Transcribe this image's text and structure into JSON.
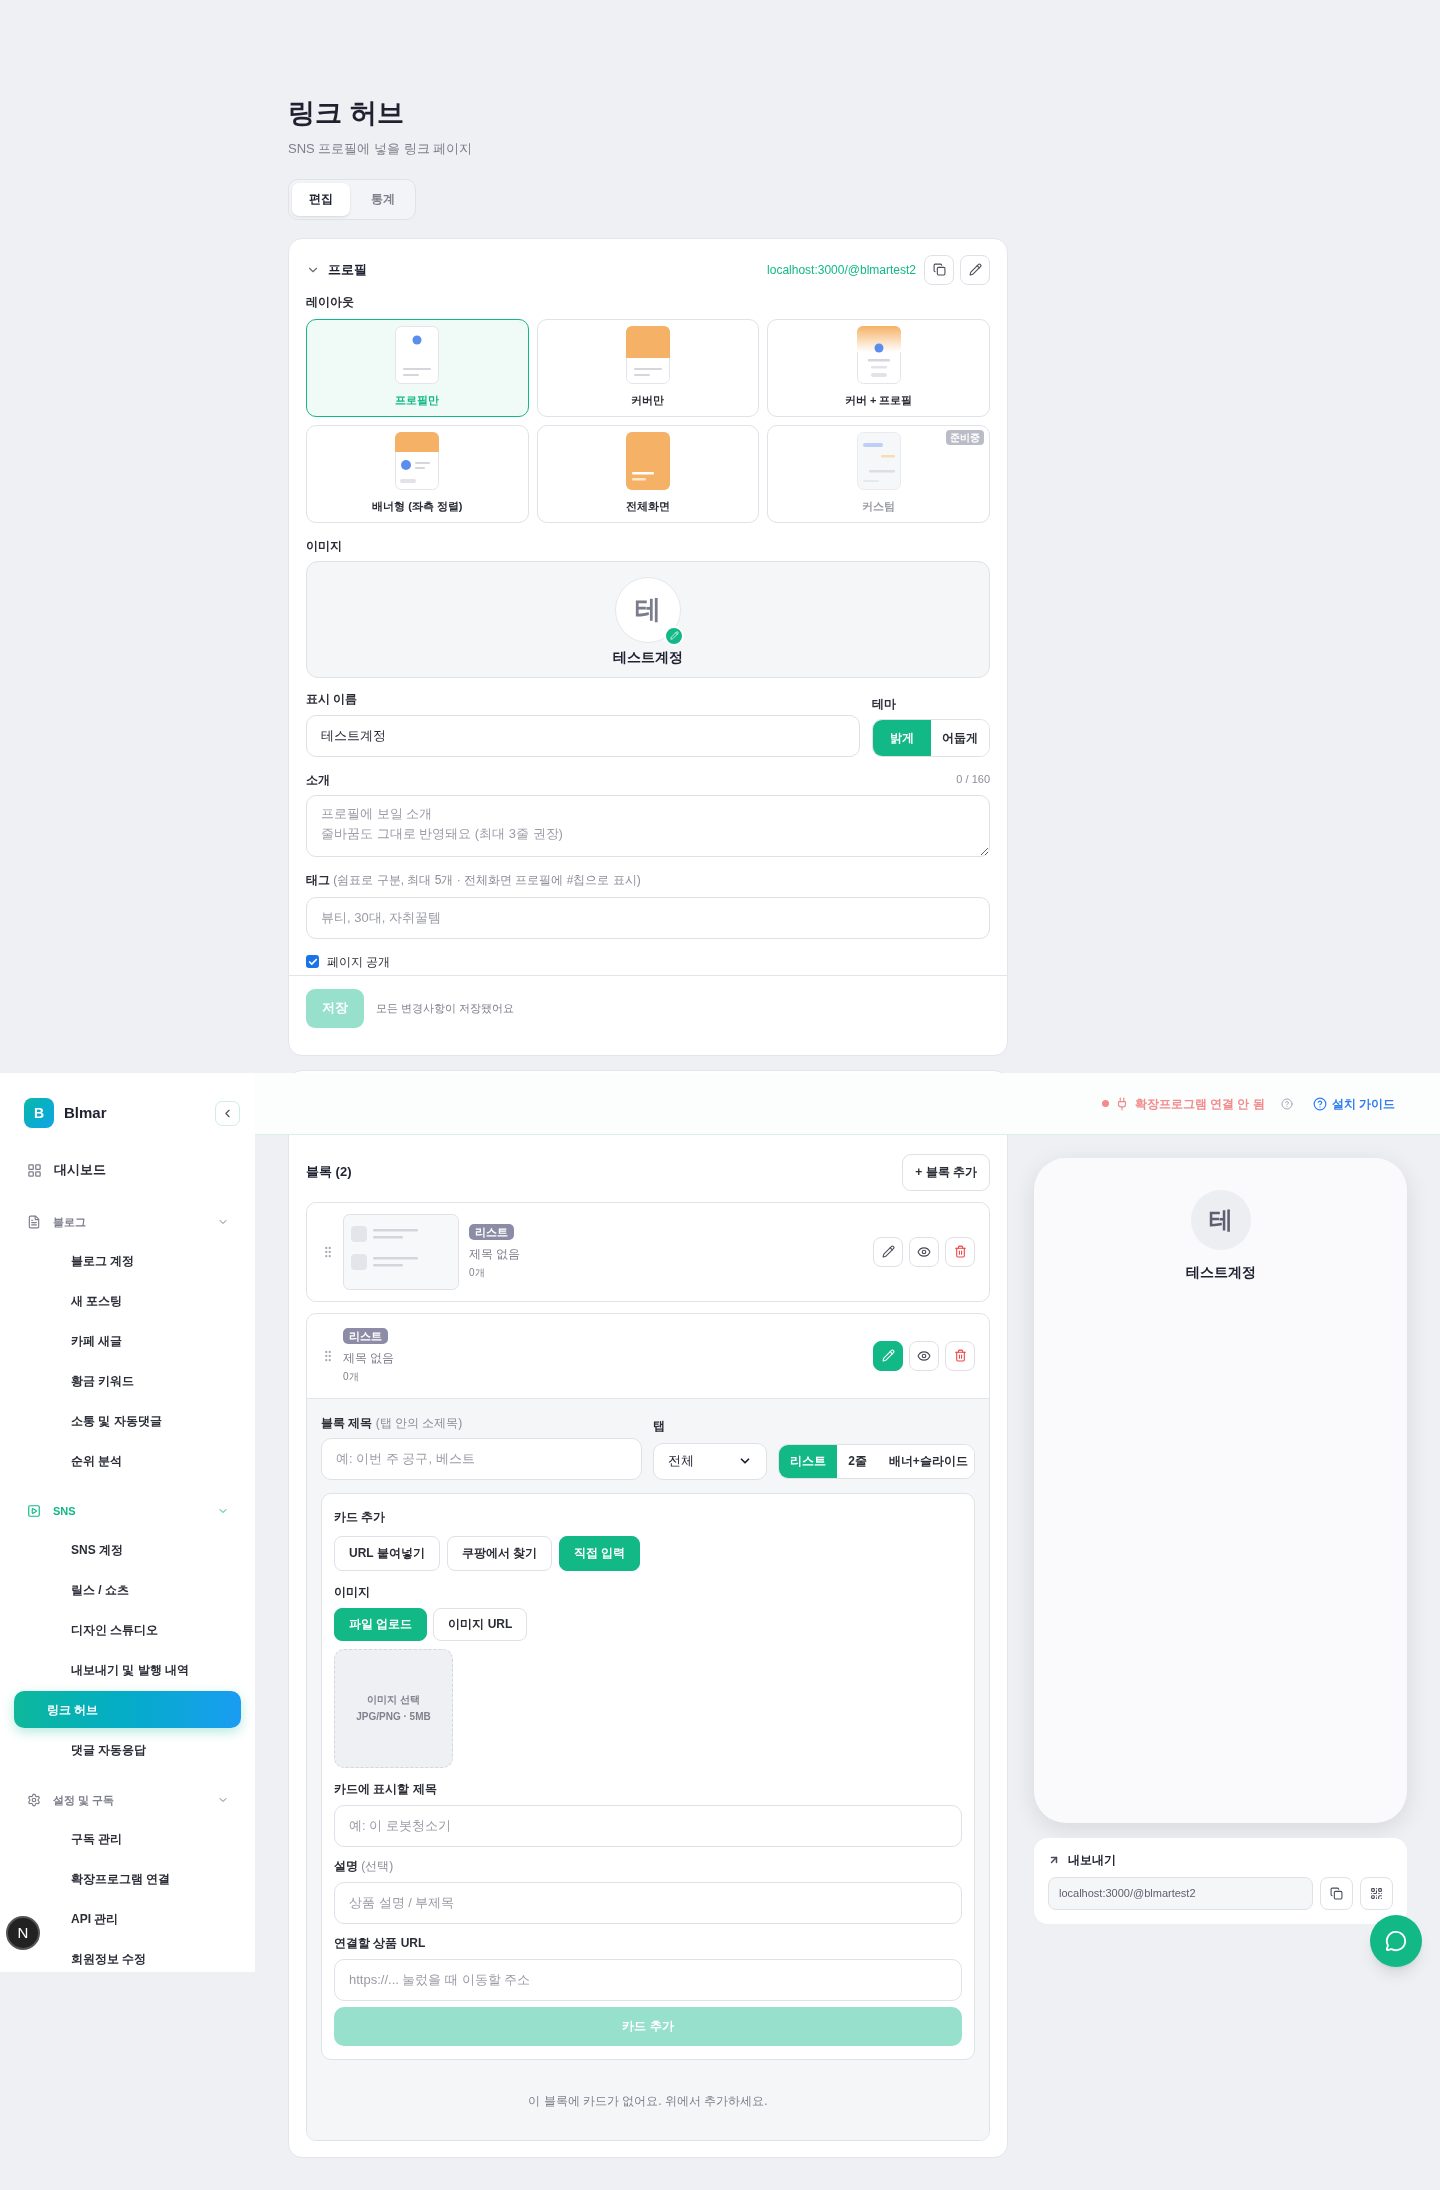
{
  "page": {
    "title": "링크 허브",
    "subtitle": "SNS 프로필에 넣을 링크 페이지"
  },
  "tabs": [
    {
      "label": "편집",
      "selected": true
    },
    {
      "label": "통계",
      "selected": false
    }
  ],
  "profile": {
    "title": "프로필",
    "expanded": true,
    "url": "localhost:3000/@blmartest2",
    "layout_label": "레이아웃",
    "layouts": [
      {
        "label": "프로필만",
        "kind": "profile",
        "selected": true,
        "disabled": false
      },
      {
        "label": "커버만",
        "kind": "cover",
        "selected": false,
        "disabled": false
      },
      {
        "label": "커버 + 프로필",
        "kind": "cover_profile",
        "selected": false,
        "disabled": false
      },
      {
        "label": "배너형 (좌측 정렬)",
        "kind": "banner",
        "selected": false,
        "disabled": false
      },
      {
        "label": "전체화면",
        "kind": "fullscreen",
        "selected": false,
        "disabled": false
      },
      {
        "label": "커스텀",
        "kind": "custom",
        "selected": false,
        "disabled": true,
        "badge": "준비중"
      }
    ],
    "image_label": "이미지",
    "avatar": "테",
    "avatar_name": "테스트계정",
    "name_label": "표시 이름",
    "name_value": "테스트계정",
    "theme_label": "테마",
    "themes": [
      {
        "label": "밝게",
        "selected": true
      },
      {
        "label": "어둡게",
        "selected": false
      }
    ],
    "intro_label": "소개",
    "intro_count": "0 / 160",
    "intro_placeholder": "프로필에 보일 소개\n줄바꿈도 그대로 반영돼요 (최대 3줄 권장)",
    "tags_label": "태그",
    "tags_hint": "(쉼표로 구분, 최대 5개 · 전체화면 프로필에 #칩으로 표시)",
    "tags_placeholder": "뷰티, 30대, 자취꿀템",
    "public": {
      "label": "페이지 공개",
      "checked": true
    },
    "save": {
      "label": "저장",
      "disabled": true
    },
    "save_status": "모든 변경사항이 저장됐어요"
  },
  "blocks": {
    "title": "블록 (2)",
    "add_label": "+ 블록 추가",
    "items": [
      {
        "badge": "리스트",
        "title": "제목 없음",
        "count": "0개",
        "thumbnail": true,
        "editing": false
      },
      {
        "badge": "리스트",
        "title": "제목 없음",
        "count": "0개",
        "thumbnail": false,
        "editing": true
      }
    ],
    "editor": {
      "title_label": "블록 제목",
      "title_hint": "(탭 안의 소제목)",
      "title_placeholder": "예: 이번 주 공구, 베스트",
      "tab_label": "탭",
      "tab_value": "전체",
      "views": [
        {
          "label": "리스트",
          "selected": true
        },
        {
          "label": "2줄",
          "selected": false
        },
        {
          "label": "배너+슬라이드",
          "selected": false
        }
      ],
      "add_card": {
        "title": "카드 추가",
        "methods": [
          {
            "label": "URL 붙여넣기",
            "selected": false
          },
          {
            "label": "쿠팡에서 찾기",
            "selected": false
          },
          {
            "label": "직접 입력",
            "selected": true
          }
        ],
        "image_label": "이미지",
        "image_sources": [
          {
            "label": "파일 업로드",
            "selected": true
          },
          {
            "label": "이미지 URL",
            "selected": false
          }
        ],
        "picker_lines": [
          "이미지 선택",
          "JPG/PNG · 5MB"
        ],
        "card_title_label": "카드에 표시할 제목",
        "card_title_placeholder": "예: 이 로봇청소기",
        "desc_label": "설명",
        "desc_hint": "(선택)",
        "desc_placeholder": "상품 설명 / 부제목",
        "url_label": "연결할 상품 URL",
        "url_placeholder": "https://... 눌렀을 때 이동할 주소",
        "submit": {
          "label": "카드 추가",
          "disabled": true
        }
      },
      "empty_text": "이 블록에 카드가 없어요. 위에서 추가하세요."
    }
  },
  "preview": {
    "avatar": "테",
    "name": "테스트계정"
  },
  "export": {
    "title": "내보내기",
    "url": "localhost:3000/@blmartest2"
  },
  "header": {
    "extension_status": {
      "label": "확장프로그램 연결 안 됨",
      "connected": false
    },
    "guide": "설치 가이드"
  },
  "sidebar": {
    "brand_initial": "B",
    "brand": "Blmar",
    "dashboard": "대시보드",
    "sections": [
      {
        "label": "블로그",
        "active": false,
        "expanded": true,
        "items": [
          {
            "label": "블로그 계정",
            "selected": false
          },
          {
            "label": "새 포스팅",
            "selected": false
          },
          {
            "label": "카페 새글",
            "selected": false
          },
          {
            "label": "황금 키워드",
            "selected": false
          },
          {
            "label": "소통 및 자동댓글",
            "selected": false
          },
          {
            "label": "순위 분석",
            "selected": false
          }
        ]
      },
      {
        "label": "SNS",
        "active": true,
        "expanded": true,
        "items": [
          {
            "label": "SNS 계정",
            "selected": false
          },
          {
            "label": "릴스 / 쇼츠",
            "selected": false
          },
          {
            "label": "디자인 스튜디오",
            "selected": false
          },
          {
            "label": "내보내기 및 발행 내역",
            "selected": false
          },
          {
            "label": "링크 허브",
            "selected": true
          },
          {
            "label": "댓글 자동응답",
            "selected": false
          }
        ]
      },
      {
        "label": "설정 및 구독",
        "active": false,
        "expanded": true,
        "items": [
          {
            "label": "구독 관리",
            "selected": false
          },
          {
            "label": "확장프로그램 연결",
            "selected": false
          },
          {
            "label": "API 관리",
            "selected": false
          },
          {
            "label": "회원정보 수정",
            "selected": false
          }
        ]
      }
    ]
  },
  "dev_badge": "N"
}
